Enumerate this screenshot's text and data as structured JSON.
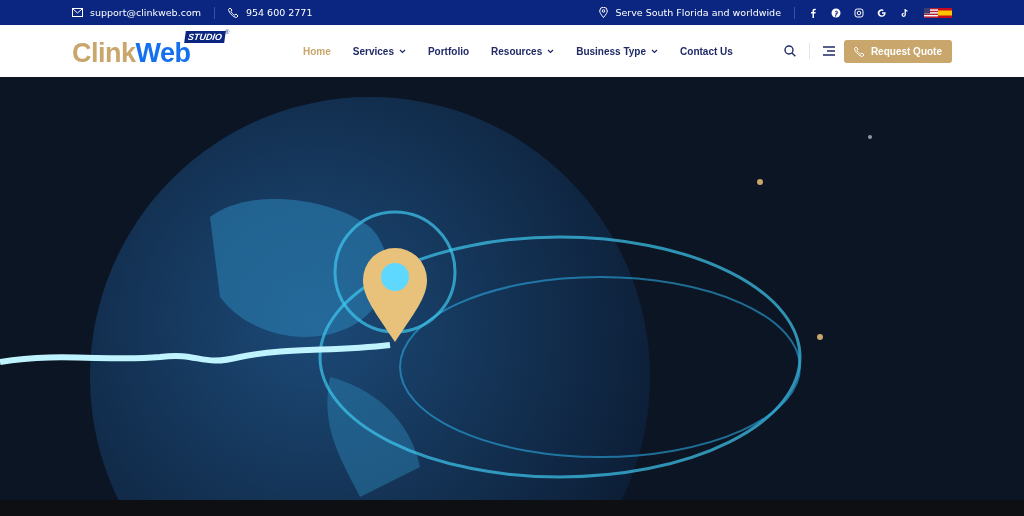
{
  "top_bar": {
    "email": "support@clinkweb.com",
    "phone": "954 600 2771",
    "location": "Serve South Florida and worldwide"
  },
  "logo": {
    "part_1": "Clink",
    "part_2": "Web",
    "badge": "STUDIO",
    "mark": "®"
  },
  "nav": [
    {
      "label": "Home",
      "selected": true,
      "dropdown": false
    },
    {
      "label": "Services",
      "selected": false,
      "dropdown": true
    },
    {
      "label": "Portfolio",
      "selected": false,
      "dropdown": false
    },
    {
      "label": "Resources",
      "selected": false,
      "dropdown": true
    },
    {
      "label": "Business Type",
      "selected": false,
      "dropdown": true
    },
    {
      "label": "Contact Us",
      "selected": false,
      "dropdown": false
    }
  ],
  "quote_button": "Request Quote"
}
